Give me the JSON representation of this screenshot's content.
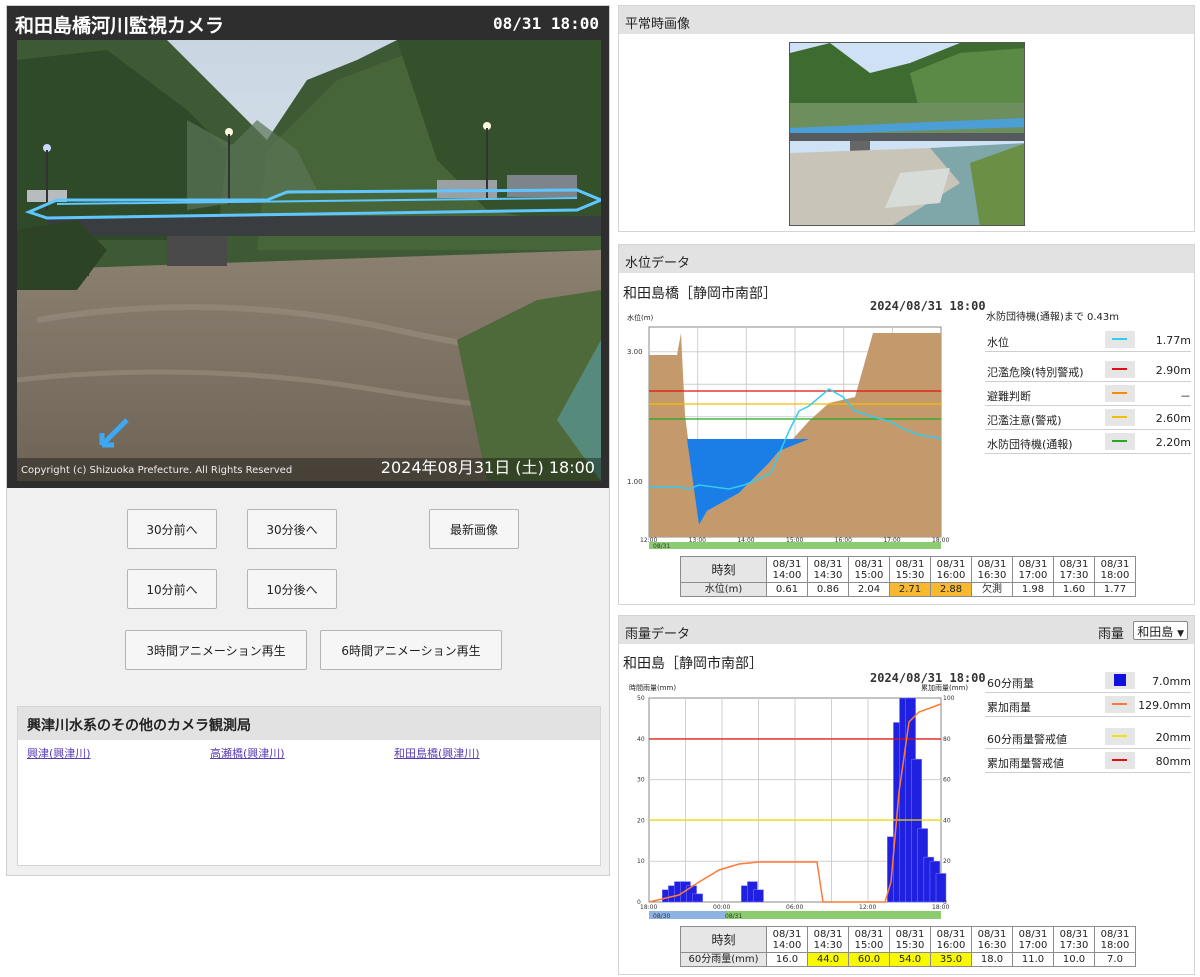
{
  "camera": {
    "title": "和田島橋河川監視カメラ",
    "time": "08/31 18:00",
    "copyright": "Copyright (c) Shizuoka Prefecture. All Rights Reserved",
    "stamp": "2024年08月31日 (土) 18:00"
  },
  "buttons": {
    "b30_before": "30分前へ",
    "b30_after": "30分後へ",
    "latest": "最新画像",
    "b10_before": "10分前へ",
    "b10_after": "10分後へ",
    "anim3": "3時間アニメーション再生",
    "anim6": "6時間アニメーション再生"
  },
  "other_cameras": {
    "title": "興津川水系のその他のカメラ観測局",
    "links": [
      "興津(興津川)",
      "高瀬橋(興津川)",
      "和田島橋(興津川)"
    ]
  },
  "normal_image": {
    "title": "平常時画像"
  },
  "water_level": {
    "panel_title": "水位データ",
    "station": "和田島橋［静岡市南部］",
    "timestamp": "2024/08/31 18:00",
    "note": "水防団待機(通報)まで 0.43m",
    "legend": [
      {
        "label": "水位",
        "value": "1.77m",
        "color": "#33ccee"
      },
      {
        "label": "氾濫危険(特別警戒)",
        "value": "2.90m",
        "color": "#e01010"
      },
      {
        "label": "避難判断",
        "value": "－",
        "color": "#ff8c00"
      },
      {
        "label": "氾濫注意(警戒)",
        "value": "2.60m",
        "color": "#f0c000"
      },
      {
        "label": "水防団待機(通報)",
        "value": "2.20m",
        "color": "#22aa22"
      }
    ],
    "table": {
      "row1_label": "時刻",
      "row2_label": "水位(m)",
      "times": [
        [
          "08/31",
          "14:00"
        ],
        [
          "08/31",
          "14:30"
        ],
        [
          "08/31",
          "15:00"
        ],
        [
          "08/31",
          "15:30"
        ],
        [
          "08/31",
          "16:00"
        ],
        [
          "08/31",
          "16:30"
        ],
        [
          "08/31",
          "17:00"
        ],
        [
          "08/31",
          "17:30"
        ],
        [
          "08/31",
          "18:00"
        ]
      ],
      "values": [
        "0.61",
        "0.86",
        "2.04",
        "2.71",
        "2.88",
        "欠測",
        "1.98",
        "1.60",
        "1.77"
      ],
      "highlight_color": "#f8b830"
    }
  },
  "rainfall": {
    "panel_title": "雨量データ",
    "select_label": "雨量",
    "select_value": "和田島",
    "station": "和田島［静岡市南部］",
    "timestamp": "2024/08/31 18:00",
    "legend": [
      {
        "label": "60分雨量",
        "value": "7.0mm",
        "color": "#1010e0"
      },
      {
        "label": "累加雨量",
        "value": "129.0mm",
        "color": "#ff7a3a"
      },
      {
        "label": "60分雨量警戒値",
        "value": "20mm",
        "color": "#f0e000"
      },
      {
        "label": "累加雨量警戒値",
        "value": "80mm",
        "color": "#e01010"
      }
    ],
    "table": {
      "row1_label": "時刻",
      "row2_label": "60分雨量(mm)",
      "times": [
        [
          "08/31",
          "14:00"
        ],
        [
          "08/31",
          "14:30"
        ],
        [
          "08/31",
          "15:00"
        ],
        [
          "08/31",
          "15:30"
        ],
        [
          "08/31",
          "16:00"
        ],
        [
          "08/31",
          "16:30"
        ],
        [
          "08/31",
          "17:00"
        ],
        [
          "08/31",
          "17:30"
        ],
        [
          "08/31",
          "18:00"
        ]
      ],
      "values": [
        "16.0",
        "44.0",
        "60.0",
        "54.0",
        "35.0",
        "18.0",
        "11.0",
        "10.0",
        "7.0"
      ],
      "highlight_color": "#f8f800"
    }
  },
  "chart_data": [
    {
      "type": "area",
      "title": "",
      "ylabel": "水位(m)",
      "ytick_labels": [
        "3.00",
        "1.00"
      ],
      "xtick_labels": [
        "12:00",
        "13:00",
        "14:00",
        "15:00",
        "16:00",
        "17:00",
        "18:00"
      ],
      "date_label": "08/31",
      "series": [
        {
          "name": "水位",
          "x": [
            "12:00",
            "12:30",
            "13:00",
            "13:10",
            "13:30",
            "14:00",
            "14:30",
            "15:00",
            "15:30",
            "15:45",
            "16:00",
            "16:30",
            "17:00",
            "17:30",
            "18:00"
          ],
          "values": [
            1.1,
            1.1,
            1.1,
            0.9,
            0.7,
            0.7,
            0.9,
            2.0,
            2.6,
            2.8,
            2.5,
            2.3,
            2.2,
            2.0,
            1.8
          ]
        }
      ],
      "thresholds": [
        {
          "name": "氾濫危険(特別警戒)",
          "value": 2.9
        },
        {
          "name": "氾濫注意(警戒)",
          "value": 2.6
        },
        {
          "name": "水防団待機(通報)",
          "value": 2.2
        }
      ]
    },
    {
      "type": "bar",
      "title": "",
      "ylabel": "時間雨量(mm)",
      "y2label": "累加雨量(mm)",
      "ylim": [
        0,
        50
      ],
      "y2lim": [
        0,
        100
      ],
      "xtick_labels": [
        "18:00",
        "00:00",
        "06:00",
        "12:00",
        "18:00"
      ],
      "date_labels": [
        "08/30",
        "08/31"
      ],
      "series": [
        {
          "name": "60分雨量",
          "x": [
            "19:30",
            "20:00",
            "20:30",
            "21:00",
            "21:30",
            "22:00",
            "02:00",
            "02:30",
            "03:00",
            "14:00",
            "14:30",
            "15:00",
            "15:30",
            "16:00",
            "16:30",
            "17:00",
            "17:30",
            "18:00"
          ],
          "values": [
            3,
            4,
            5,
            5,
            4,
            2,
            4,
            5,
            3,
            16,
            44,
            60,
            54,
            35,
            18,
            11,
            10,
            7
          ]
        },
        {
          "name": "累加雨量",
          "x": [
            "18:00",
            "19:30",
            "22:00",
            "00:00",
            "08:00",
            "13:00",
            "14:00",
            "15:00",
            "16:00",
            "18:00"
          ],
          "values": [
            0,
            4,
            16,
            19,
            19,
            0,
            16,
            120,
            125,
            129
          ]
        }
      ],
      "thresholds": [
        {
          "name": "60分雨量警戒値",
          "value": 20
        },
        {
          "name": "累加雨量警戒値",
          "value": 80
        }
      ]
    }
  ]
}
